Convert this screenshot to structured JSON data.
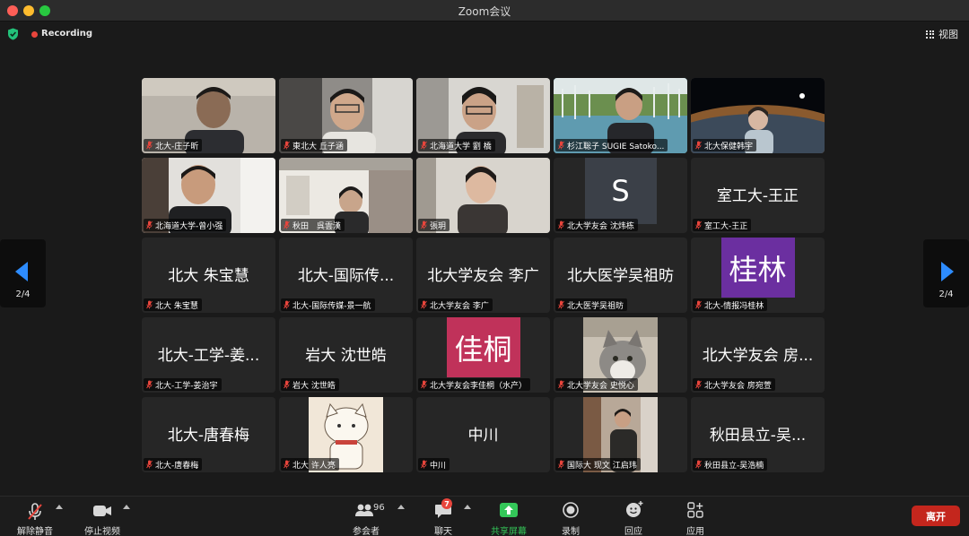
{
  "window": {
    "title": "Zoom会议"
  },
  "topbar": {
    "recording_label": "Recording",
    "view_label": "视图"
  },
  "pager": {
    "left": "2/4",
    "right": "2/4"
  },
  "tiles": [
    {
      "label": "北大-庄子昕"
    },
    {
      "label": "東北大 丘子涵"
    },
    {
      "label": "北海道大学 劉 橋"
    },
    {
      "label": "杉江聡子 SUGIE Satoko..."
    },
    {
      "label": "北大保健韩宇"
    },
    {
      "label": "北海道大学-曾小强"
    },
    {
      "label": "秋田　呉雲漢"
    },
    {
      "label": "張玥"
    },
    {
      "label": "北大学友会 沈炜栋",
      "avatar_text": "S"
    },
    {
      "label": "室工大-王正",
      "center_text": "室工大-王正"
    },
    {
      "label": "北大 朱宝慧",
      "center_text": "北大 朱宝慧"
    },
    {
      "label": "北大-国际传媒-景一航",
      "center_text": "北大-国际传..."
    },
    {
      "label": "北大学友会 李广",
      "center_text": "北大学友会 李广"
    },
    {
      "label": "北大医学吴祖昉",
      "center_text": "北大医学吴祖昉"
    },
    {
      "label": "北大-情报冯桂林",
      "avatar_text": "桂林"
    },
    {
      "label": "北大-工学-姜治宇",
      "center_text": "北大-工学-姜..."
    },
    {
      "label": "岩大 沈世皓",
      "center_text": "岩大 沈世皓"
    },
    {
      "label": "北大学友会李佳桐（水产）",
      "avatar_text": "佳桐"
    },
    {
      "label": "北大学友会 史悦心"
    },
    {
      "label": "北大学友会 房宛萱",
      "center_text": "北大学友会 房..."
    },
    {
      "label": "北大-唐春梅",
      "center_text": "北大-唐春梅"
    },
    {
      "label": "北大 许人亮"
    },
    {
      "label": "中川",
      "center_text": "中川"
    },
    {
      "label": "国际大 现文 江启玮"
    },
    {
      "label": "秋田县立-吴浩楠",
      "center_text": "秋田县立-吴..."
    }
  ],
  "toolbar": {
    "unmute_label": "解除静音",
    "stop_video_label": "停止视频",
    "participants_label": "参会者",
    "participants_count": "96",
    "chat_label": "聊天",
    "chat_badge": "7",
    "share_label": "共享屏幕",
    "record_label": "录制",
    "reactions_label": "回应",
    "apps_label": "应用",
    "leave_label": "离开"
  },
  "colors": {
    "accent_blue": "#2d8cff",
    "share_green": "#34c759",
    "leave_red": "#c4261d",
    "avatar_s": "#3b4048",
    "avatar_guilin": "#6b2fa0",
    "avatar_jiatong": "#c0325a",
    "active_speaker": "#7dd7d4"
  }
}
